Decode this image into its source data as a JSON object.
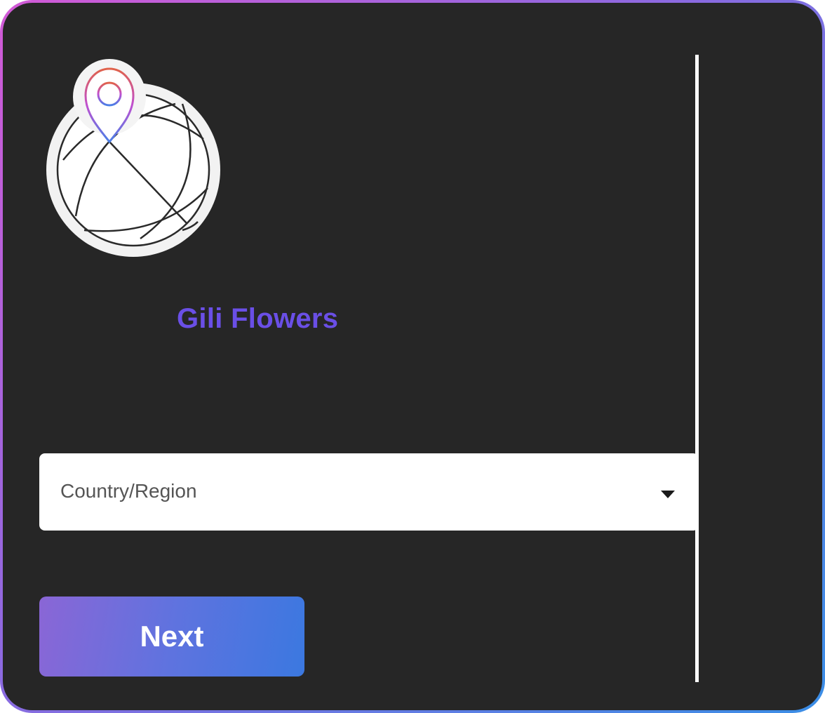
{
  "app": {
    "brand_name": "Gili Flowers",
    "logo_icon": "globe-with-location-pin-icon"
  },
  "form": {
    "country_select": {
      "placeholder": "Country/Region",
      "value": "",
      "icon": "caret-down-icon"
    },
    "next_button": {
      "label": "Next"
    }
  },
  "colors": {
    "background": "#262626",
    "brand_text": "#6a4fe6",
    "button_gradient_start": "#8a66d6",
    "button_gradient_end": "#3b78e0",
    "frame_gradient_start": "#d25ad6",
    "frame_gradient_end": "#3a8ee6"
  }
}
